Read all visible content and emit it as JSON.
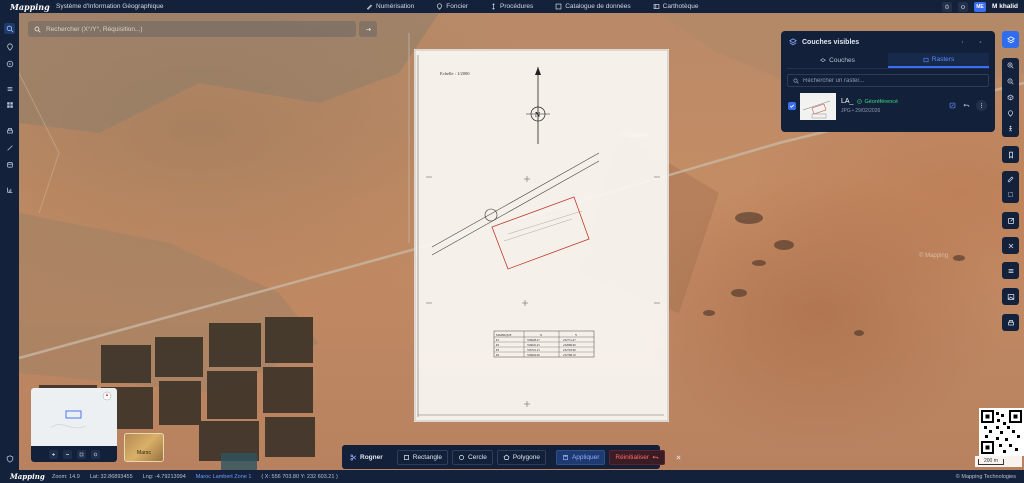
{
  "topbar": {
    "logo": "Mapping",
    "app_title": "Système d'Information Géographique",
    "nav": [
      {
        "label": "Numérisation",
        "icon": "pen-icon"
      },
      {
        "label": "Foncier",
        "icon": "map-pin-icon"
      },
      {
        "label": "Procédures",
        "icon": "flow-icon"
      },
      {
        "label": "Catalogue de données",
        "icon": "database-icon"
      },
      {
        "label": "Carthotèque",
        "icon": "map-icon"
      }
    ],
    "user_initials": "ME",
    "user_name": "M khalid"
  },
  "search": {
    "placeholder": "Rechercher (X°/Y°, Réquisition...)"
  },
  "panel": {
    "title": "Couches visibles",
    "tabs": [
      {
        "label": "Couches",
        "active": false
      },
      {
        "label": "Rasters",
        "active": true
      }
    ],
    "search_placeholder": "Rechercher un raster...",
    "raster": {
      "name": "LA_",
      "status": "Géoréférencé",
      "meta": "JPG • 29/02/2026",
      "checked": true
    }
  },
  "plan": {
    "scale_text": "Echelle : 1/2000",
    "north_label": "N",
    "table_headers": [
      "MATRIQUE",
      "X",
      "Y"
    ],
    "table_rows": [
      [
        "P1",
        "556628.27",
        "232751.47"
      ],
      [
        "P2",
        "556645.25",
        "232686.90"
      ],
      [
        "P3",
        "556710.15",
        "232703.90"
      ],
      [
        "P4",
        "556694.00",
        "232768.10"
      ]
    ]
  },
  "minimap": {
    "basemap_label": "Maroc"
  },
  "cropbar": {
    "title": "Rogner",
    "rectangle": "Rectangle",
    "circle": "Cercle",
    "polygon": "Polygone",
    "apply": "Appliquer",
    "reset": "Réinitialiser"
  },
  "scale": {
    "label": "200 m"
  },
  "footer": {
    "logo": "Mapping",
    "zoom": "Zoom: 14.9",
    "lat": "Lat: 32.86893455",
    "lng": "Lng: -4.79213994",
    "projection": "Maroc Lambert Zone 1",
    "coords": "( X: 556 703.80 Y: 232 603.21 )",
    "copyright": "© Mapping Technologies"
  },
  "watermark": "© Mapping",
  "colors": {
    "accent": "#3a6df0",
    "success": "#3ddc84",
    "danger": "#ff6b6b",
    "bar": "#14213a"
  }
}
